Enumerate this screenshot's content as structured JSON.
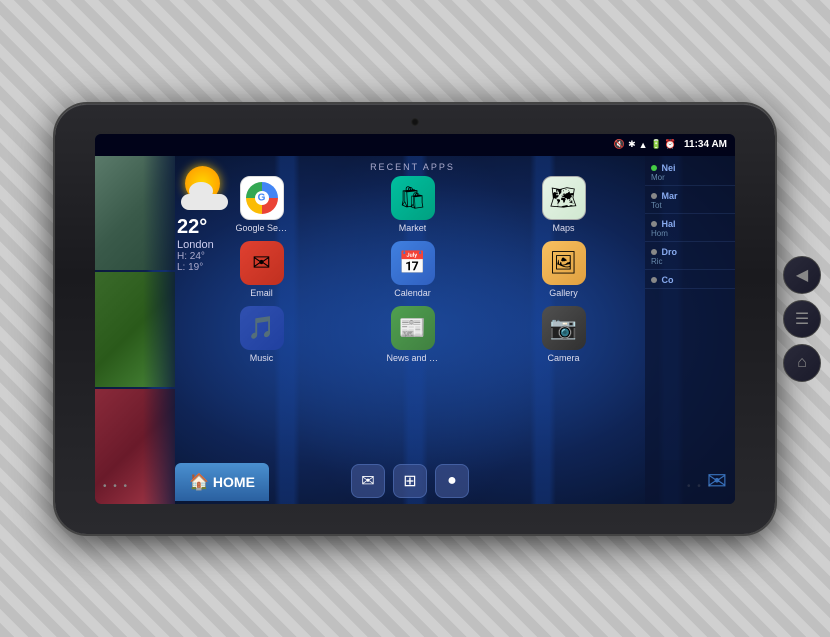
{
  "tablet": {
    "status_bar": {
      "time": "11:34 AM",
      "icons": [
        "volume-off",
        "bluetooth",
        "wifi",
        "battery",
        "alarm"
      ]
    },
    "weather": {
      "temperature": "22°",
      "city": "London",
      "high": "H: 24°",
      "low": "L: 19°"
    },
    "recent_apps_title": "RECENT APPS",
    "apps": [
      {
        "id": "google-search",
        "label": "Google Search",
        "type": "google-search"
      },
      {
        "id": "market",
        "label": "Market",
        "type": "market"
      },
      {
        "id": "maps",
        "label": "Maps",
        "type": "maps"
      },
      {
        "id": "email",
        "label": "Email",
        "type": "email"
      },
      {
        "id": "calendar",
        "label": "Calendar",
        "type": "calendar"
      },
      {
        "id": "gallery",
        "label": "Gallery",
        "type": "gallery"
      },
      {
        "id": "music",
        "label": "Music",
        "type": "music"
      },
      {
        "id": "news-weather",
        "label": "News and Wi",
        "type": "news"
      },
      {
        "id": "camera",
        "label": "Camera",
        "type": "camera"
      }
    ],
    "home_label": "HOME",
    "dock_icons": [
      "email",
      "apps",
      "search"
    ],
    "contacts": [
      {
        "name": "Nei",
        "status": "Mor",
        "online": true
      },
      {
        "name": "Mar",
        "status": "Tot",
        "online": false
      },
      {
        "name": "Hal",
        "status": "Hom",
        "online": false
      },
      {
        "name": "Dro",
        "status": "Ric",
        "online": false
      },
      {
        "name": "Co",
        "status": "",
        "online": false
      }
    ],
    "nav_buttons": [
      "back",
      "menu",
      "home"
    ]
  }
}
